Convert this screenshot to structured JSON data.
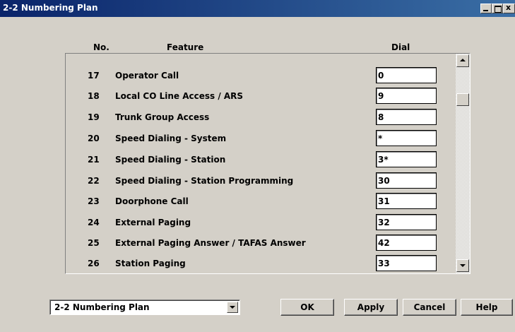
{
  "window": {
    "title": "2-2 Numbering Plan"
  },
  "table": {
    "headers": {
      "no": "No.",
      "feature": "Feature",
      "dial": "Dial"
    },
    "rows": [
      {
        "no": "17",
        "feature": "Operator Call",
        "dial": "0"
      },
      {
        "no": "18",
        "feature": "Local CO Line Access / ARS",
        "dial": "9"
      },
      {
        "no": "19",
        "feature": "Trunk Group Access",
        "dial": "8"
      },
      {
        "no": "20",
        "feature": "Speed Dialing - System",
        "dial": "*"
      },
      {
        "no": "21",
        "feature": "Speed Dialing - Station",
        "dial": "3*"
      },
      {
        "no": "22",
        "feature": "Speed Dialing - Station Programming",
        "dial": "30"
      },
      {
        "no": "23",
        "feature": "Doorphone Call",
        "dial": "31"
      },
      {
        "no": "24",
        "feature": "External Paging",
        "dial": "32"
      },
      {
        "no": "25",
        "feature": "External Paging Answer / TAFAS Answer",
        "dial": "42"
      },
      {
        "no": "26",
        "feature": "Station Paging",
        "dial": "33"
      }
    ]
  },
  "footer": {
    "combo_value": "2-2 Numbering Plan",
    "ok_label": "OK",
    "apply_label": "Apply",
    "cancel_label": "Cancel",
    "help_label": "Help"
  },
  "colors": {
    "titlebar_start": "#0a246a",
    "titlebar_end": "#3a6ea5",
    "face": "#d4d0c8"
  }
}
